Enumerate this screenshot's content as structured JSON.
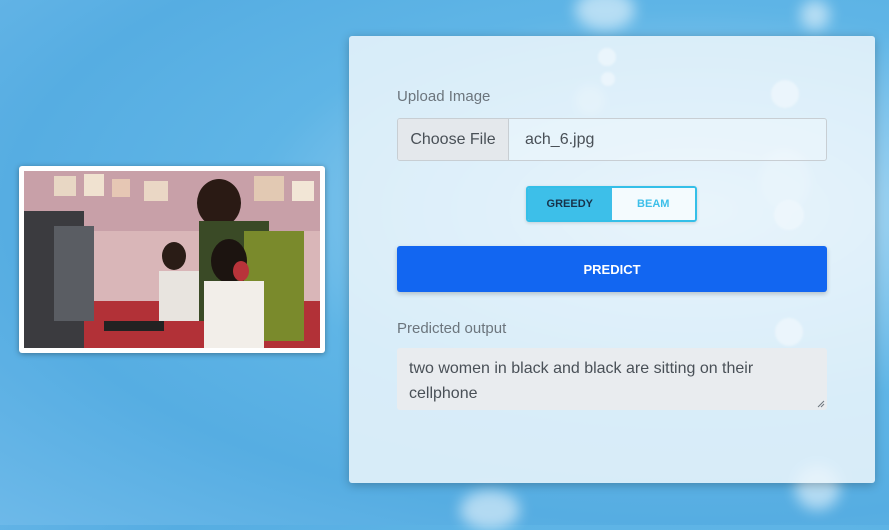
{
  "form": {
    "upload_label": "Upload Image",
    "choose_file": "Choose File",
    "file_name": "ach_6.jpg",
    "decoding": {
      "greedy": "GREEDY",
      "beam": "BEAM",
      "selected": "GREEDY"
    },
    "predict": "PREDICT",
    "output_label": "Predicted output",
    "output_text": "two women in black and black are sitting on their cellphone"
  },
  "colors": {
    "accent_blue": "#1266f1",
    "toggle_cyan": "#3dbfe9",
    "background": "#5fb5e6"
  }
}
